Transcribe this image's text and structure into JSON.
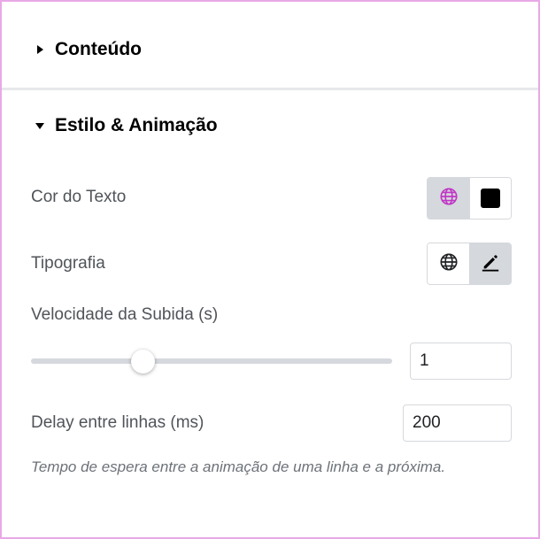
{
  "sections": {
    "content": {
      "title": "Conteúdo",
      "expanded": false
    },
    "style": {
      "title": "Estilo & Animação",
      "expanded": true
    }
  },
  "controls": {
    "text_color": {
      "label": "Cor do Texto",
      "options": [
        "globe-icon",
        "color-swatch"
      ],
      "active": "globe-icon",
      "swatch_color": "#000000",
      "globe_color": "#c036c6"
    },
    "typography": {
      "label": "Tipografia",
      "options": [
        "globe-icon",
        "pencil-icon"
      ],
      "active": "pencil-icon"
    },
    "rise_speed": {
      "label": "Velocidade da Subida (s)",
      "value": "1",
      "slider_fraction": 0.31
    },
    "line_delay": {
      "label": "Delay entre linhas (ms)",
      "value": "200",
      "help": "Tempo de espera entre a animação de uma linha e a próxima."
    }
  },
  "colors": {
    "border_accent": "#e8a9e6",
    "active_segment": "#d5d8dc"
  }
}
